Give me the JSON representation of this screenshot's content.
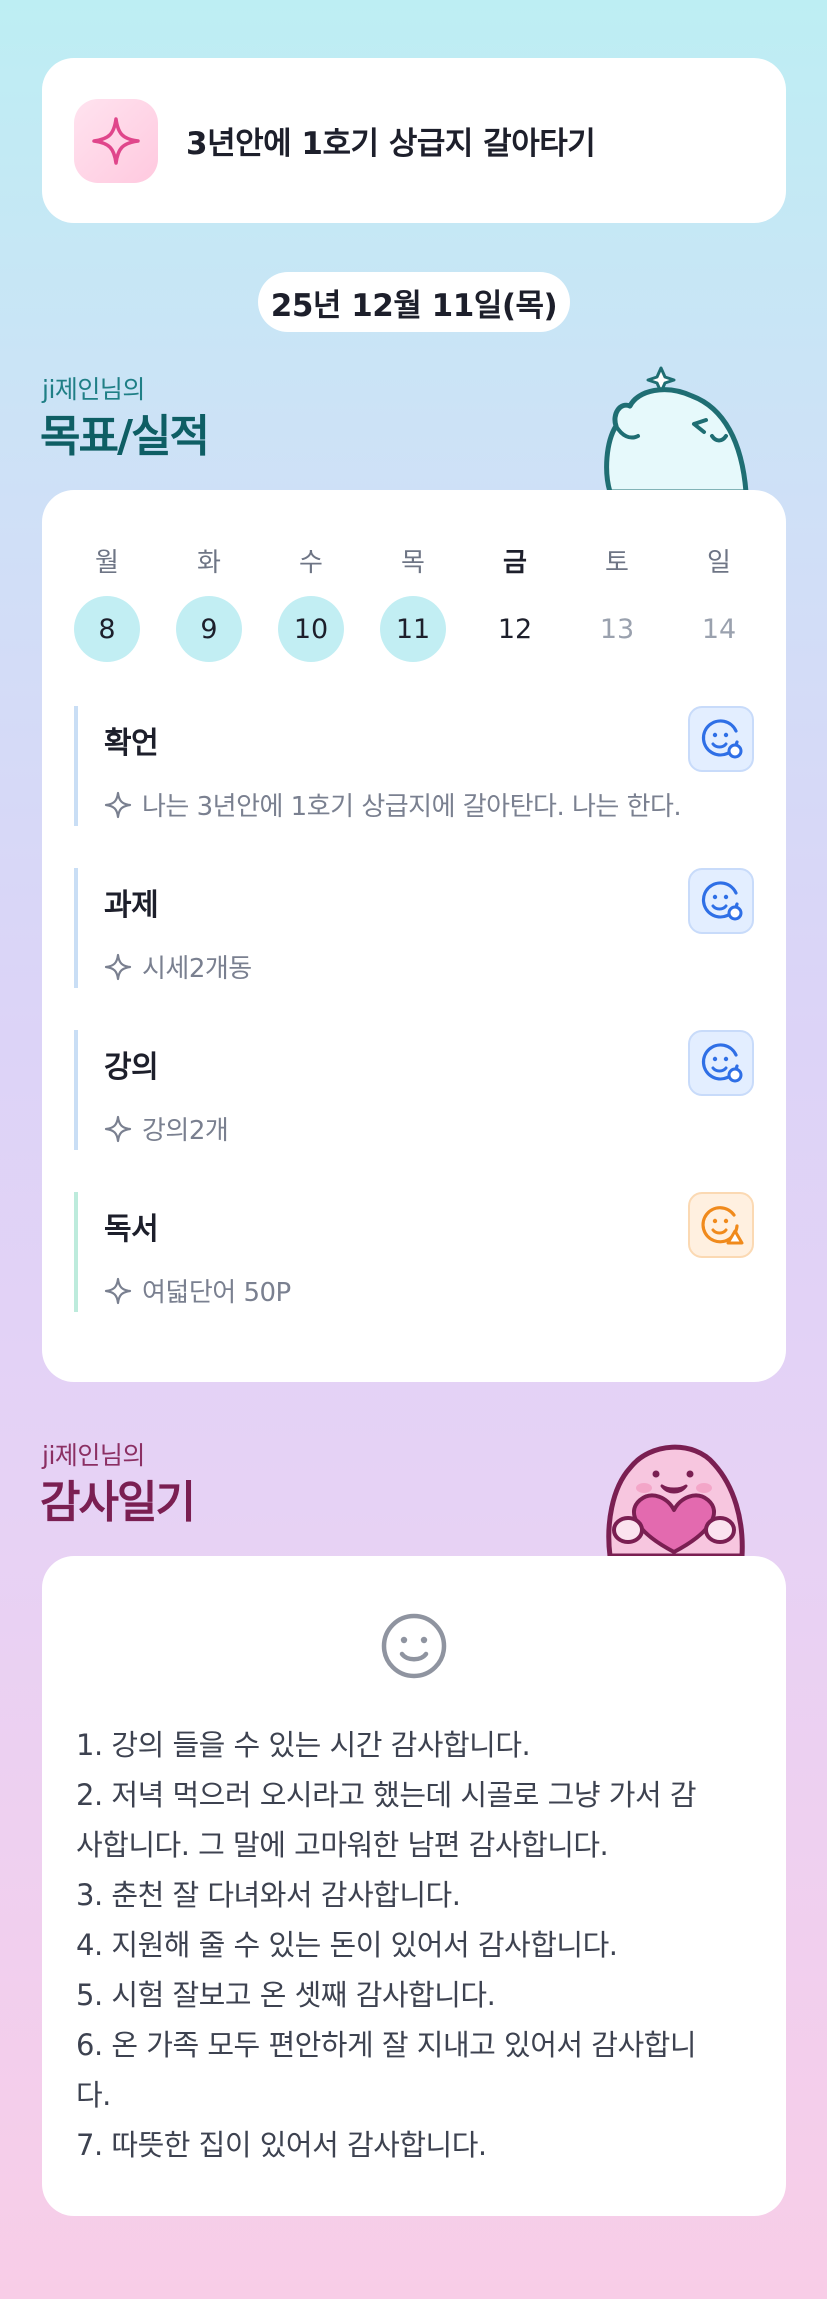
{
  "goal": {
    "icon": "sparkle-icon",
    "text": "3년안에 1호기 상급지 갈아타기"
  },
  "date": "25년 12월 11일(목)",
  "goals_section": {
    "owner": "ji제인님의",
    "title": "목표/실적"
  },
  "week": [
    {
      "label": "월",
      "num": "8",
      "state": "done"
    },
    {
      "label": "화",
      "num": "9",
      "state": "done"
    },
    {
      "label": "수",
      "num": "10",
      "state": "done"
    },
    {
      "label": "목",
      "num": "11",
      "state": "done"
    },
    {
      "label": "금",
      "num": "12",
      "state": "today"
    },
    {
      "label": "토",
      "num": "13",
      "state": "future"
    },
    {
      "label": "일",
      "num": "14",
      "state": "future"
    }
  ],
  "tasks": [
    {
      "name": "확언",
      "desc": "나는 3년안에 1호기 상급지에 갈아탄다. 나는 한다.",
      "status_icon": "smile-check-icon",
      "status_color": "#2f6fe6"
    },
    {
      "name": "과제",
      "desc": "시세2개동",
      "status_icon": "smile-check-icon",
      "status_color": "#2f6fe6"
    },
    {
      "name": "강의",
      "desc": "강의2개",
      "status_icon": "smile-check-icon",
      "status_color": "#2f6fe6"
    },
    {
      "name": "독서",
      "desc": "여덟단어 50P",
      "status_icon": "smile-warning-icon",
      "status_color": "#f08a1c"
    }
  ],
  "gratitude_section": {
    "owner": "ji제인님의",
    "title": "감사일기"
  },
  "journal": {
    "mood_icon": "smile-icon",
    "lines": [
      "1. 강의 들을 수 있는 시간 감사합니다.",
      "2. 저녁 먹으러 오시라고 했는데 시골로 그냥 가서 감",
      "사합니다. 그 말에 고마워한 남편 감사합니다.",
      "3. 춘천 잘 다녀와서 감사합니다.",
      "4. 지원해 줄 수 있는 돈이 있어서 감사합니다.",
      "5. 시험 잘보고 온 셋째 감사합니다.",
      "6. 온 가족 모두 편안하게 잘 지내고 있어서 감사합니",
      "다.",
      "7. 따뜻한 집이 있어서 감사합니다."
    ]
  },
  "colors": {
    "accent_teal": "#0e5e64",
    "accent_plum": "#7a1f52",
    "done_day": "#c2eef3"
  }
}
